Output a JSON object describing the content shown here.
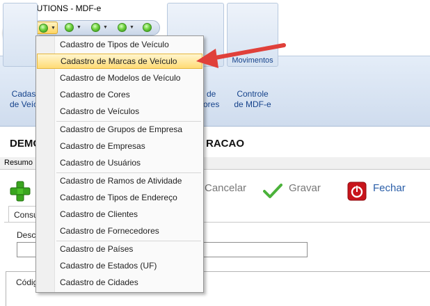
{
  "window": {
    "title": "SOLLUTIONS - MDF-e"
  },
  "ribbon": {
    "button_cadastros_line1": "Cadas",
    "button_cadastros_line2": "de Veíc",
    "button_hidden_line1": "de",
    "button_hidden_line2": "ores",
    "controle_line1": "Controle",
    "controle_line2": "de MDF-e",
    "movimentos_caption": "Movimentos"
  },
  "content": {
    "heading_left": "DEMO",
    "heading_right": "RACAO",
    "tab_resumo": "Resumo",
    "toolbar": {
      "cancelar": "Cancelar",
      "gravar": "Gravar",
      "fechar": "Fechar"
    },
    "inner_tab": "Consu",
    "desc_label": "Desc",
    "grid_col": "Códig"
  },
  "menu": {
    "groups": [
      [
        "Cadastro de Tipos de Veículo",
        "Cadastro de Marcas de Veículo",
        "Cadastro de Modelos de Veículo",
        "Cadastro de Cores",
        "Cadastro de Veículos"
      ],
      [
        "Cadastro de Grupos de Empresa",
        "Cadastro de Empresas",
        "Cadastro de Usuários"
      ],
      [
        "Cadastro de Ramos de Atividade",
        "Cadastro de Tipos de Endereço",
        "Cadastro de Clientes",
        "Cadastro de Fornecedores"
      ],
      [
        "Cadastro de Países",
        "Cadastro de Estados (UF)",
        "Cadastro de Cidades"
      ]
    ],
    "highlighted": "Cadastro de Marcas de Veículo"
  },
  "colors": {
    "accent": "#15428b",
    "highlight": "#ffdb75",
    "arrow": "#e0403a",
    "fechar": "#2a5ea8"
  },
  "icons": [
    "app-icon",
    "app-orb-icon",
    "green-dot-icon",
    "chevron-down-icon",
    "plus-icon",
    "check-icon",
    "power-icon"
  ]
}
